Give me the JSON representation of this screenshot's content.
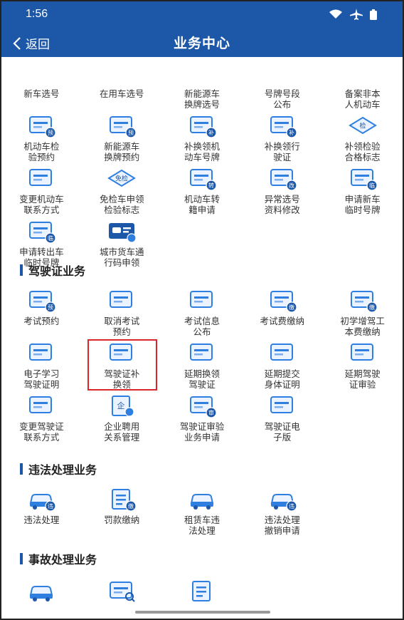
{
  "status_bar": {
    "time": "1:56",
    "icons": [
      "wifi-icon",
      "airplane-icon",
      "battery-icon"
    ]
  },
  "header": {
    "back_label": "返回",
    "title": "业务中心"
  },
  "colors": {
    "brand": "#1d58a8",
    "icon_blue": "#2f7fe0",
    "highlight": "#d9262b"
  },
  "top_group": [
    {
      "label": "新车选号",
      "icon": ""
    },
    {
      "label": "在用车选号",
      "icon": ""
    },
    {
      "label": "新能源车\n换牌选号",
      "icon": ""
    },
    {
      "label": "号牌号段\n公布",
      "icon": ""
    },
    {
      "label": "备案非本\n人机动车",
      "icon": ""
    },
    {
      "label": "机动车检\n验预约",
      "icon": "check-appointment-icon",
      "badge": "预"
    },
    {
      "label": "新能源车\n换牌预约",
      "icon": "plate-appointment-icon",
      "badge": "预"
    },
    {
      "label": "补换领机\n动车号牌",
      "icon": "plate-replace-icon",
      "badge": "补"
    },
    {
      "label": "补换领行\n驶证",
      "icon": "license-replace-icon",
      "badge": "补"
    },
    {
      "label": "补领检验\n合格标志",
      "icon": "inspection-mark-icon",
      "tag": "检"
    },
    {
      "label": "变更机动车\n联系方式",
      "icon": "vehicle-contact-icon"
    },
    {
      "label": "免检车申领\n检验标志",
      "icon": "exempt-mark-icon",
      "tag": "免检"
    },
    {
      "label": "机动车转\n籍申请",
      "icon": "transfer-icon",
      "badge": "转"
    },
    {
      "label": "异常选号\n资料修改",
      "icon": "abnormal-edit-icon",
      "badge": "改"
    },
    {
      "label": "申请新车\n临时号牌",
      "icon": "temp-plate-new-icon",
      "badge": "临"
    },
    {
      "label": "申请转出车\n临时号牌",
      "icon": "temp-plate-out-icon",
      "badge": "临"
    },
    {
      "label": "城市货车通\n行码申领",
      "icon": "truck-pass-icon"
    }
  ],
  "sections": [
    {
      "title": "驾驶证业务",
      "items": [
        {
          "label": "考试预约",
          "icon": "exam-appointment-icon",
          "badge": "预"
        },
        {
          "label": "取消考试\n预约",
          "icon": "cancel-exam-icon"
        },
        {
          "label": "考试信息\n公布",
          "icon": "exam-info-icon"
        },
        {
          "label": "考试费缴纳",
          "icon": "exam-fee-icon",
          "badge": "缴"
        },
        {
          "label": "初学增驾工\n本费缴纳",
          "icon": "cost-fee-icon",
          "badge": "缴"
        },
        {
          "label": "电子学习\n驾驶证明",
          "icon": "e-study-icon"
        },
        {
          "label": "驾驶证补\n换领",
          "icon": "license-card-replace-icon"
        },
        {
          "label": "延期换领\n驾驶证",
          "icon": "delay-renew-icon"
        },
        {
          "label": "延期提交\n身体证明",
          "icon": "health-proof-icon"
        },
        {
          "label": "延期驾驶\n证审验",
          "icon": "delay-audit-icon"
        },
        {
          "label": "变更驾驶证\n联系方式",
          "icon": "license-contact-icon"
        },
        {
          "label": "企业聘用\n关系管理",
          "icon": "company-hire-icon"
        },
        {
          "label": "驾驶证审验\n业务申请",
          "icon": "audit-apply-icon",
          "badge": "审"
        },
        {
          "label": "驾驶证电\n子版",
          "icon": "e-license-icon"
        }
      ]
    },
    {
      "title": "违法处理业务",
      "items": [
        {
          "label": "违法处理",
          "icon": "violation-icon",
          "badge": "违"
        },
        {
          "label": "罚款缴纳",
          "icon": "fine-pay-icon",
          "badge": "缴"
        },
        {
          "label": "租赁车违\n法处理",
          "icon": "rental-violation-icon"
        },
        {
          "label": "违法处理\n撤销申请",
          "icon": "violation-revoke-icon",
          "badge": "违"
        }
      ]
    },
    {
      "title": "事故处理业务",
      "items": [
        {
          "label": "",
          "icon": "accident-car-icon"
        },
        {
          "label": "",
          "icon": "accident-search-icon"
        },
        {
          "label": "",
          "icon": "accident-doc-icon"
        }
      ]
    }
  ]
}
